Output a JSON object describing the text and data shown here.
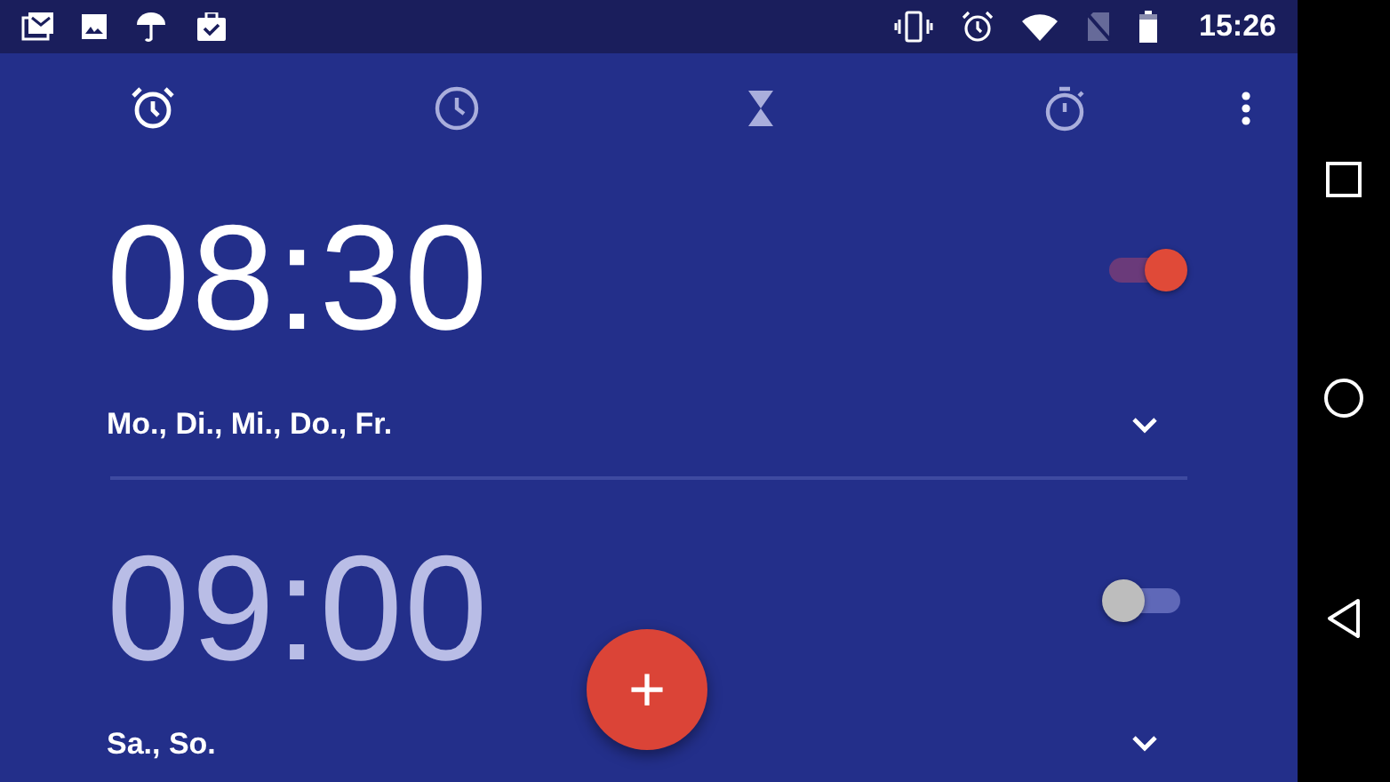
{
  "status_bar": {
    "time": "15:26"
  },
  "tabs": [
    {
      "selected": true
    },
    {
      "selected": false
    },
    {
      "selected": false
    },
    {
      "selected": false
    }
  ],
  "alarms": [
    {
      "time": "08:30",
      "days": "Mo., Di., Mi., Do., Fr.",
      "on": true
    },
    {
      "time": "09:00",
      "days": "Sa., So.",
      "on": false
    }
  ],
  "fab": {
    "label": "+"
  }
}
